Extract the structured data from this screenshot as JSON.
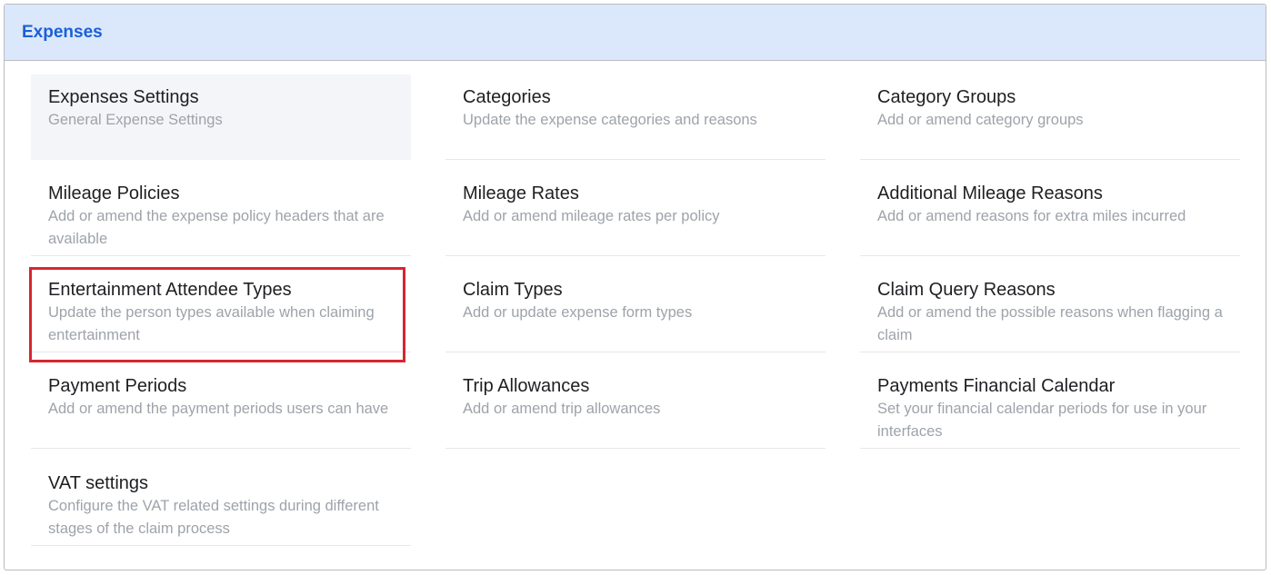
{
  "header": {
    "title": "Expenses"
  },
  "tiles": [
    {
      "title": "Expenses Settings",
      "desc": "General Expense Settings"
    },
    {
      "title": "Categories",
      "desc": "Update the expense categories and reasons"
    },
    {
      "title": "Category Groups",
      "desc": "Add or amend category groups"
    },
    {
      "title": "Mileage Policies",
      "desc": "Add or amend the expense policy headers that are available"
    },
    {
      "title": "Mileage Rates",
      "desc": "Add or amend mileage rates per policy"
    },
    {
      "title": "Additional Mileage Reasons",
      "desc": "Add or amend reasons for extra miles incurred"
    },
    {
      "title": "Entertainment Attendee Types",
      "desc": "Update the person types available when claiming entertainment"
    },
    {
      "title": "Claim Types",
      "desc": "Add or update expense form types"
    },
    {
      "title": "Claim Query Reasons",
      "desc": "Add or amend the possible reasons when flagging a claim"
    },
    {
      "title": "Payment Periods",
      "desc": "Add or amend the payment periods users can have"
    },
    {
      "title": "Trip Allowances",
      "desc": "Add or amend trip allowances"
    },
    {
      "title": "Payments Financial Calendar",
      "desc": "Set your financial calendar periods for use in your interfaces"
    },
    {
      "title": "VAT settings",
      "desc": "Configure the VAT related settings during different stages of the claim process"
    }
  ],
  "colors": {
    "header_bg": "#dbe8fb",
    "header_title": "#1a5fd6",
    "highlight": "#d72630",
    "active_tile_bg": "#f4f5f9"
  }
}
